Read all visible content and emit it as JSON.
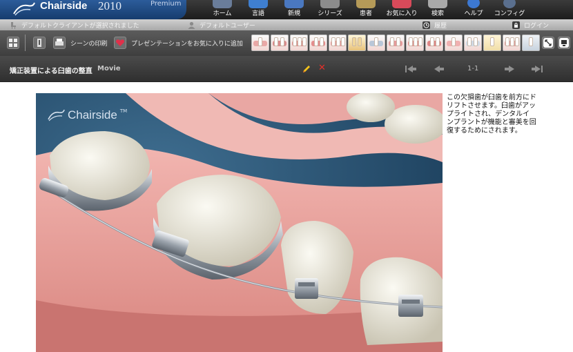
{
  "app": {
    "name": "Chairside",
    "year": "2010",
    "edition": "Premium"
  },
  "nav": [
    {
      "label": "ホーム",
      "icon": "home-icon"
    },
    {
      "label": "言語",
      "icon": "language-icon"
    },
    {
      "label": "新規",
      "icon": "new-icon"
    },
    {
      "label": "シリーズ",
      "icon": "series-icon"
    },
    {
      "label": "患者",
      "icon": "patient-icon"
    },
    {
      "label": "お気に入り",
      "icon": "favorites-icon"
    },
    {
      "label": "検索",
      "icon": "search-icon"
    },
    {
      "label": "ヘルプ",
      "icon": "help-icon"
    },
    {
      "label": "コンフィグ",
      "icon": "config-icon"
    }
  ],
  "status": {
    "client": "デフォルトクライアントが選択されました",
    "user": "デフォルトユーザー",
    "history": "履歴",
    "login": "ログイン"
  },
  "toolbar": {
    "print_label": "シーンの印刷",
    "favorite_label": "プレゼンテーションをお気に入りに追加"
  },
  "scene": {
    "title": "矯正装置による臼歯の整直",
    "media_type": "Movie",
    "pager": "1-1",
    "watermark": "Chairside",
    "watermark_mark": "TM",
    "description": "この欠損歯が臼歯を前方にドリフトさせます。臼歯がアップライトされ、デンタルインプラントが機能と審美を回復するためにされます。"
  },
  "colors": {
    "brand_blue": "#1f4f8e",
    "delete_red": "#e4302a",
    "edit_yellow": "#f2c21b"
  }
}
